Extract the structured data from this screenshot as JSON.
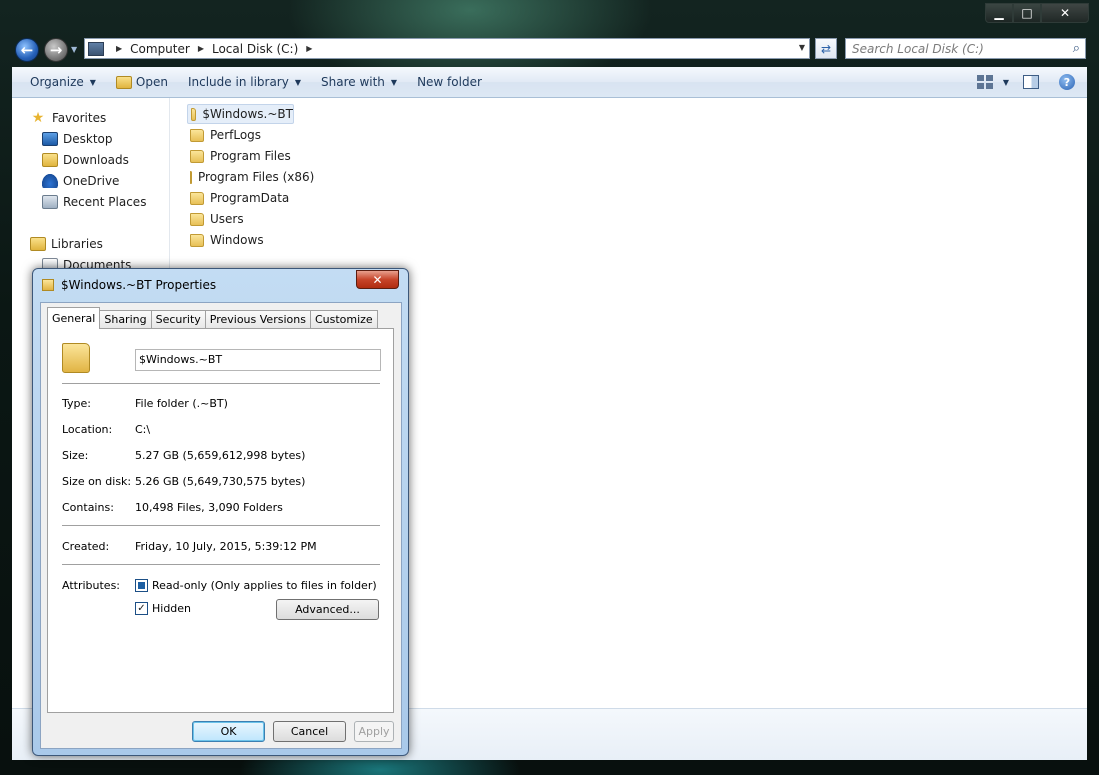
{
  "window": {
    "controls": {
      "minimize": "▁",
      "maximize": "□",
      "close": "✕"
    }
  },
  "address": {
    "crumbs": [
      "Computer",
      "Local Disk (C:)"
    ],
    "search_placeholder": "Search Local Disk (C:)"
  },
  "toolbar": {
    "organize": "Organize",
    "open": "Open",
    "include_in_library": "Include in library",
    "share_with": "Share with",
    "new_folder": "New folder"
  },
  "navpane": {
    "favorites": "Favorites",
    "favorite_items": [
      "Desktop",
      "Downloads",
      "OneDrive",
      "Recent Places"
    ],
    "libraries": "Libraries",
    "library_items": [
      "Documents"
    ]
  },
  "files": [
    "$Windows.~BT",
    "PerfLogs",
    "Program Files",
    "Program Files (x86)",
    "ProgramData",
    "Users",
    "Windows"
  ],
  "dialog": {
    "title": "$Windows.~BT Properties",
    "close": "✕",
    "tabs": [
      "General",
      "Sharing",
      "Security",
      "Previous Versions",
      "Customize"
    ],
    "name": "$Windows.~BT",
    "props": {
      "type_label": "Type:",
      "type_value": "File folder (.~BT)",
      "location_label": "Location:",
      "location_value": "C:\\",
      "size_label": "Size:",
      "size_value": "5.27 GB (5,659,612,998 bytes)",
      "size_on_disk_label": "Size on disk:",
      "size_on_disk_value": "5.26 GB (5,649,730,575 bytes)",
      "contains_label": "Contains:",
      "contains_value": "10,498 Files, 3,090 Folders",
      "created_label": "Created:",
      "created_value": "Friday, 10 July, 2015, 5:39:12 PM",
      "attributes_label": "Attributes:"
    },
    "attributes": {
      "readonly": "Read-only (Only applies to files in folder)",
      "hidden": "Hidden",
      "hidden_checked": "✓",
      "advanced": "Advanced..."
    },
    "buttons": {
      "ok": "OK",
      "cancel": "Cancel",
      "apply": "Apply"
    }
  }
}
